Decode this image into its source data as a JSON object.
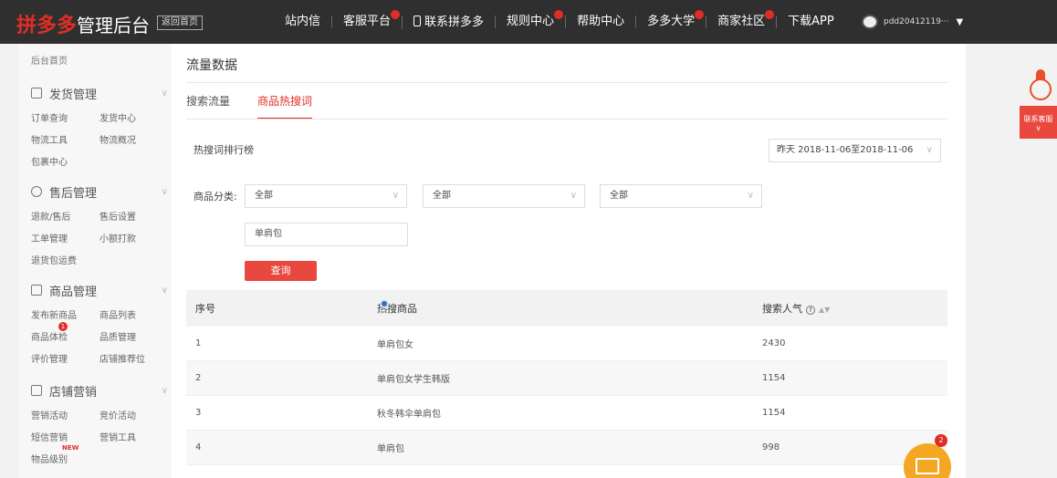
{
  "topbar": {
    "logo_brand": "拼多多",
    "logo_title": "管理后台",
    "home_button": "返回首页",
    "nav": [
      {
        "label": "站内信",
        "dot": false,
        "phone": false
      },
      {
        "label": "客服平台",
        "dot": true,
        "phone": false
      },
      {
        "label": "联系拼多多",
        "dot": false,
        "phone": true
      },
      {
        "label": "规则中心",
        "dot": true,
        "phone": false
      },
      {
        "label": "帮助中心",
        "dot": false,
        "phone": false
      },
      {
        "label": "多多大学",
        "dot": true,
        "phone": false
      },
      {
        "label": "商家社区",
        "dot": true,
        "phone": false
      },
      {
        "label": "下载APP",
        "dot": false,
        "phone": false
      }
    ],
    "username": "pdd20412119···"
  },
  "sidebar": {
    "home": "后台首页",
    "groups": [
      {
        "title": "发货管理",
        "rows": [
          [
            "订单查询",
            "发货中心"
          ],
          [
            "物流工具",
            "物流概况"
          ],
          [
            "包裹中心",
            ""
          ]
        ]
      },
      {
        "title": "售后管理",
        "rows": [
          [
            "退款/售后",
            "售后设置"
          ],
          [
            "工单管理",
            "小额打款"
          ],
          [
            "退货包运费",
            ""
          ]
        ]
      },
      {
        "title": "商品管理",
        "rows": [
          [
            "发布新商品",
            "商品列表"
          ],
          [
            "商品体检",
            "品质管理"
          ],
          [
            "评价管理",
            "店铺推荐位"
          ]
        ]
      },
      {
        "title": "店铺营销",
        "rows": [
          [
            "营销活动",
            "竞价活动"
          ],
          [
            "短信营销",
            "营销工具"
          ],
          [
            "物品级别",
            ""
          ]
        ]
      }
    ],
    "badge_count": "1",
    "hot_tag": "NEW"
  },
  "main": {
    "title": "流量数据",
    "tabs": [
      "搜索流量",
      "商品热搜词"
    ],
    "rank_label": "热搜词排行榜",
    "date_range": "昨天 2018-11-06至2018-11-06",
    "category_label": "商品分类:",
    "selects": [
      "全部",
      "全部",
      "全部"
    ],
    "keyword": "单肩包",
    "query_button": "查询",
    "table": {
      "headers": [
        "序号",
        "热搜商品",
        "搜索人气"
      ],
      "rows": [
        [
          "1",
          "单肩包女",
          "2430"
        ],
        [
          "2",
          "单肩包女学生韩版",
          "1154"
        ],
        [
          "3",
          "秋冬韩伞单肩包",
          "1154"
        ],
        [
          "4",
          "单肩包",
          "998"
        ]
      ]
    }
  },
  "float": {
    "contact": "联系客服",
    "mail_badge": "2"
  }
}
